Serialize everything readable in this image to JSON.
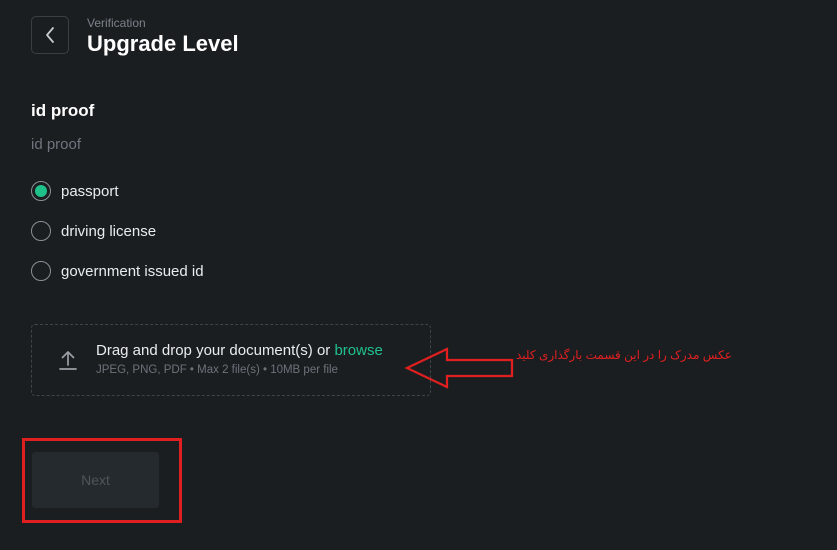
{
  "header": {
    "breadcrumb": "Verification",
    "title": "Upgrade Level"
  },
  "section": {
    "title": "id proof",
    "subtitle": "id proof"
  },
  "options": [
    {
      "label": "passport",
      "selected": true
    },
    {
      "label": "driving license",
      "selected": false
    },
    {
      "label": "government issued id",
      "selected": false
    }
  ],
  "dropzone": {
    "prompt": "Drag and drop your document(s) or",
    "browse_label": "browse",
    "hint": "JPEG, PNG, PDF • Max 2 file(s) • 10MB per file"
  },
  "next_label": "Next",
  "annotation": {
    "text": "عکس مدرک را در این قسمت بارگذاری کلید"
  },
  "colors": {
    "background": "#1b1e21",
    "accent": "#1fc18a",
    "annotation": "#e02020"
  },
  "icons": {
    "back": "chevron-left-icon",
    "upload": "upload-icon",
    "annotation_arrow": "arrow-left-icon"
  }
}
